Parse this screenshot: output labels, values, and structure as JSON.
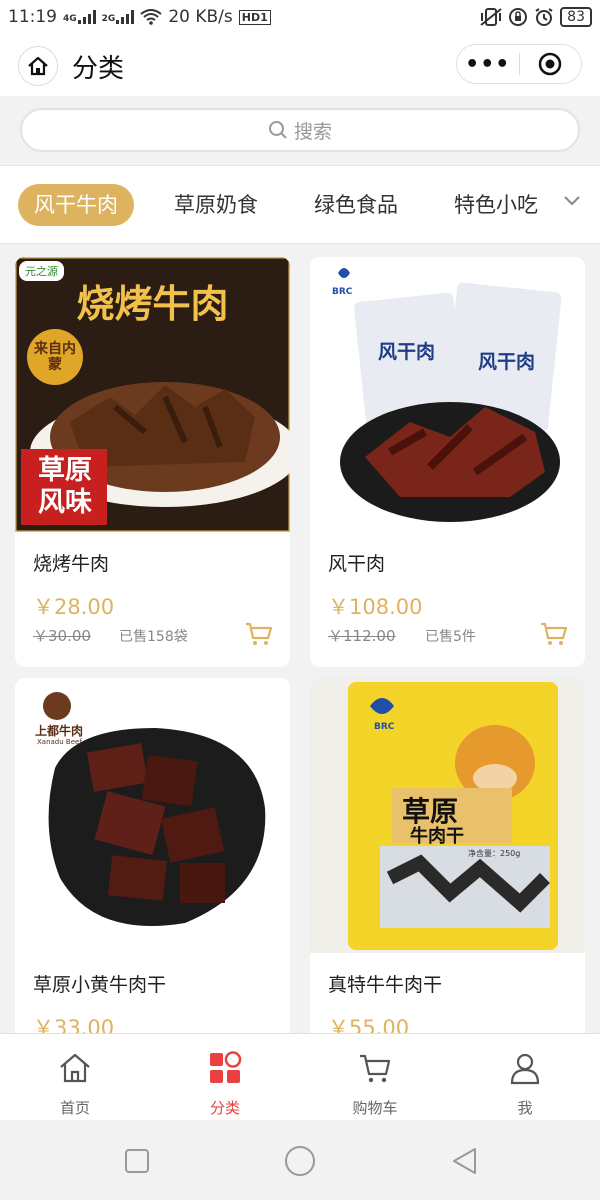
{
  "status": {
    "time": "11:19",
    "net1": "4G",
    "net2": "2G",
    "speed": "20 KB/s",
    "hd": "HD1",
    "battery": "83"
  },
  "header": {
    "title": "分类",
    "more": "•••",
    "home_icon": "home-icon",
    "capsule_icon": "target-icon"
  },
  "search": {
    "placeholder": "搜索"
  },
  "tabs": [
    {
      "label": "风干牛肉",
      "active": true
    },
    {
      "label": "草原奶食",
      "active": false
    },
    {
      "label": "绿色食品",
      "active": false
    },
    {
      "label": "特色小吃",
      "active": false
    }
  ],
  "products": [
    {
      "name": "烧烤牛肉",
      "price": "￥28.00",
      "orig": "￥30.00",
      "sold": "已售158袋",
      "img_brand": "元之源",
      "img_title": "烧烤牛肉",
      "img_badge_top": "来自内蒙",
      "img_badge_bottom": "草原风味"
    },
    {
      "name": "风干肉",
      "price": "￥108.00",
      "orig": "￥112.00",
      "sold": "已售5件",
      "img_bag_label": "风干肉",
      "img_bag_label2": "风干肉",
      "img_brand": "BRC"
    },
    {
      "name": "草原小黄牛肉干",
      "price": "￥33.00",
      "img_brand": "上都牛肉",
      "img_brand_en": "Xanadu Beef"
    },
    {
      "name": "真特牛牛肉干",
      "price": "￥55.00",
      "img_brand": "BRC",
      "img_bag_title": "草原",
      "img_bag_sub": "牛肉干",
      "img_net": "净含量：250g"
    }
  ],
  "bottom_nav": [
    {
      "label": "首页",
      "icon": "home-icon",
      "active": false
    },
    {
      "label": "分类",
      "icon": "category-icon",
      "active": true
    },
    {
      "label": "购物车",
      "icon": "cart-icon",
      "active": false
    },
    {
      "label": "我",
      "icon": "user-icon",
      "active": false
    }
  ],
  "colors": {
    "accent": "#ddb35f",
    "active_nav": "#e94040"
  }
}
